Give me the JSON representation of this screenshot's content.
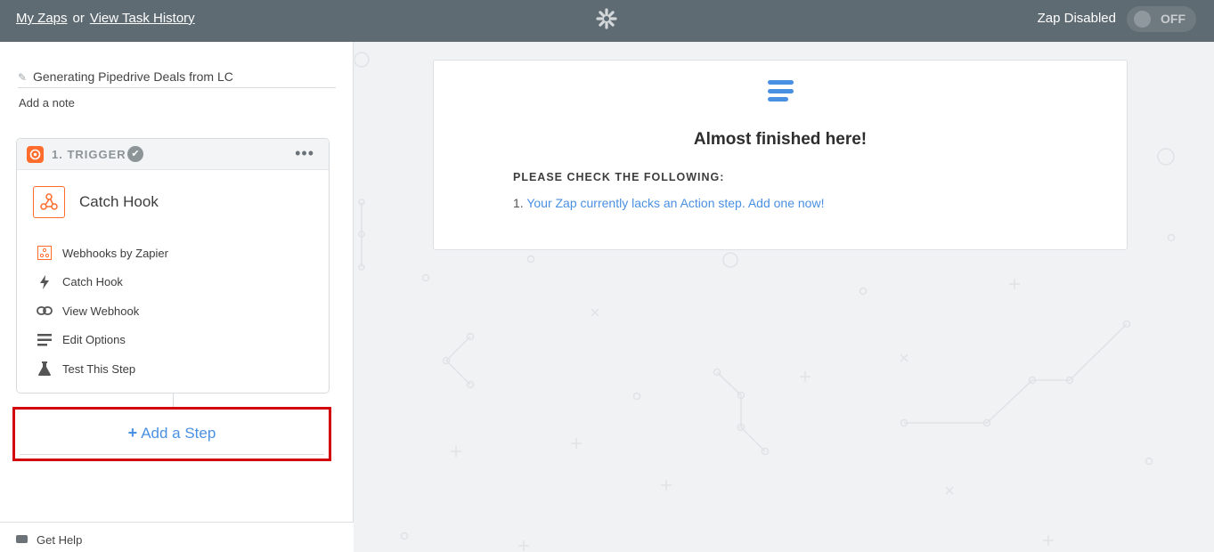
{
  "topbar": {
    "my_zaps": "My Zaps",
    "or": "or",
    "task_history": "View Task History",
    "status": "Zap Disabled",
    "toggle": "OFF"
  },
  "sidebar": {
    "zap_name": "Generating Pipedrive Deals from LC",
    "add_note": "Add a note",
    "trigger": {
      "label": "1. TRIGGER",
      "app_title": "Catch Hook",
      "menu": [
        {
          "label": "Webhooks by Zapier",
          "icon": "webhook-icon"
        },
        {
          "label": "Catch Hook",
          "icon": "bolt-icon"
        },
        {
          "label": "View Webhook",
          "icon": "link-icon"
        },
        {
          "label": "Edit Options",
          "icon": "lines-icon"
        },
        {
          "label": "Test This Step",
          "icon": "flask-icon"
        }
      ]
    },
    "add_step": "Add a Step",
    "help": "Get Help"
  },
  "panel": {
    "title": "Almost finished here!",
    "subtitle": "PLEASE CHECK THE FOLLOWING:",
    "item_number": "1.",
    "item_text": "Your Zap currently lacks an Action step. Add one now!"
  },
  "colors": {
    "topbar": "#5f6b72",
    "accent": "#4a90e2",
    "trigger": "#ff6c2c",
    "highlight": "#d2000a"
  }
}
